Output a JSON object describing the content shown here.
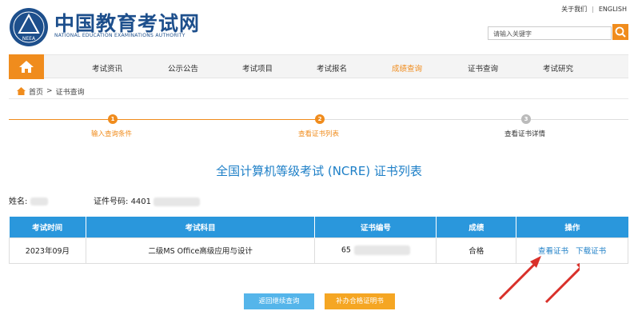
{
  "header": {
    "site_name": "中国教育考试网",
    "site_sub": "NATIONAL EDUCATION EXAMINATIONS AUTHORITY",
    "logo_text": "NEEA",
    "top_links": [
      "关于我们",
      "ENGLISH"
    ],
    "search_placeholder": "请输入关键字"
  },
  "nav": {
    "items": [
      "考试资讯",
      "公示公告",
      "考试项目",
      "考试报名",
      "成绩查询",
      "证书查询",
      "考试研究"
    ]
  },
  "breadcrumb": [
    "首页",
    ">",
    "证书查询"
  ],
  "steps": [
    {
      "num": "1",
      "label": "输入查询条件"
    },
    {
      "num": "2",
      "label": "查看证书列表"
    },
    {
      "num": "3",
      "label": "查看证书详情"
    }
  ],
  "title": "全国计算机等级考试 (NCRE) 证书列表",
  "person": {
    "name_label": "姓名:",
    "id_label": "证件号码:",
    "id_prefix": "4401"
  },
  "table": {
    "headers": [
      "考试时间",
      "考试科目",
      "证书编号",
      "成绩",
      "操作"
    ],
    "rows": [
      {
        "time": "2023年09月",
        "subject": "二级MS Office高级应用与设计",
        "cert_no_prefix": "65",
        "result": "合格",
        "action_view": "查看证书",
        "action_download": "下载证书"
      }
    ]
  },
  "buttons": {
    "back": "返回继续查询",
    "supplement": "补办合格证明书"
  },
  "colors": {
    "brand_blue": "#1d4f8c",
    "accent_orange": "#f08c1d",
    "table_header": "#2a97dc",
    "arrow_red": "#d9302a"
  }
}
